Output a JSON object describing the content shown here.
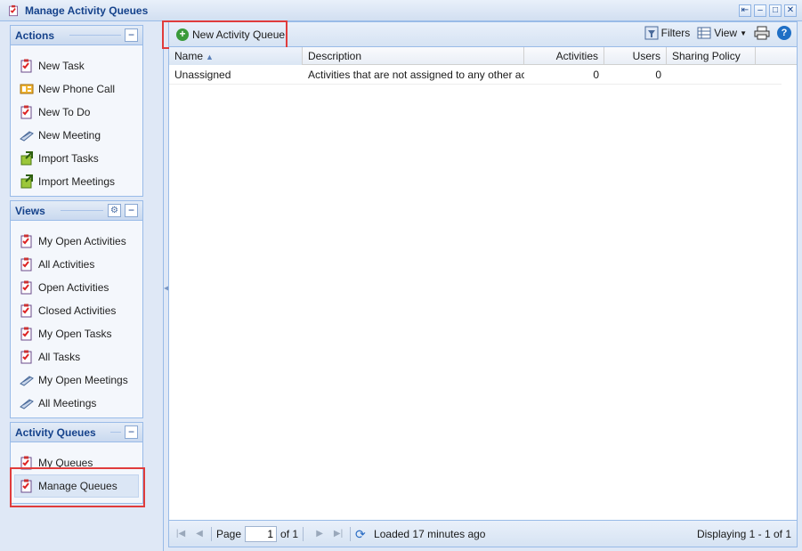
{
  "window": {
    "title": "Manage Activity Queues",
    "controls": [
      "restore",
      "minimize",
      "maximize",
      "close"
    ]
  },
  "sidebar": {
    "actions": {
      "header": "Actions",
      "items": [
        {
          "label": "New Task",
          "icon": "task-icon"
        },
        {
          "label": "New Phone Call",
          "icon": "phone-call-icon"
        },
        {
          "label": "New To Do",
          "icon": "todo-icon"
        },
        {
          "label": "New Meeting",
          "icon": "meeting-icon"
        },
        {
          "label": "Import Tasks",
          "icon": "import-icon"
        },
        {
          "label": "Import Meetings",
          "icon": "import-icon"
        }
      ]
    },
    "views": {
      "header": "Views",
      "items": [
        {
          "label": "My Open Activities",
          "icon": "task-icon"
        },
        {
          "label": "All Activities",
          "icon": "task-icon"
        },
        {
          "label": "Open Activities",
          "icon": "task-icon"
        },
        {
          "label": "Closed Activities",
          "icon": "task-icon"
        },
        {
          "label": "My Open Tasks",
          "icon": "task-icon"
        },
        {
          "label": "All Tasks",
          "icon": "task-icon"
        },
        {
          "label": "My Open Meetings",
          "icon": "meeting-icon"
        },
        {
          "label": "All Meetings",
          "icon": "meeting-icon"
        }
      ]
    },
    "queues": {
      "header": "Activity Queues",
      "items": [
        {
          "label": "My Queues",
          "icon": "task-icon"
        },
        {
          "label": "Manage Queues",
          "icon": "task-icon",
          "selected": true
        }
      ]
    }
  },
  "toolbar": {
    "new_queue_label": "New Activity Queue",
    "filters_label": "Filters",
    "view_label": "View"
  },
  "grid": {
    "columns": [
      "Name",
      "Description",
      "Activities",
      "Users",
      "Sharing Policy"
    ],
    "sorted_column": "Name",
    "rows": [
      {
        "name": "Unassigned",
        "description": "Activities that are not assigned to any other act…",
        "activities": "0",
        "users": "0",
        "sharing": ""
      }
    ]
  },
  "pager": {
    "page_label": "Page",
    "page_value": "1",
    "of_label": "of 1",
    "status": "Loaded 17 minutes ago",
    "displaying": "Displaying 1 - 1 of 1"
  },
  "colors": {
    "header_text": "#15428b",
    "border": "#99bbe8",
    "highlight": "#e03c3c",
    "add_green": "#3a9a3a"
  }
}
